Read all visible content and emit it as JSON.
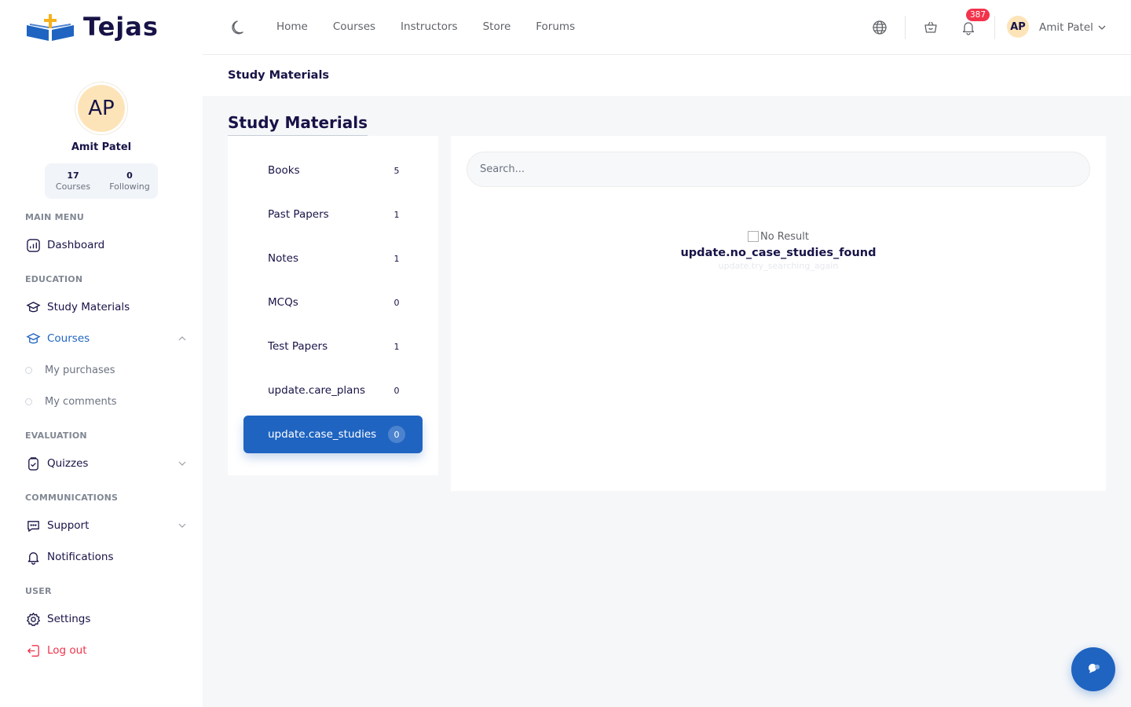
{
  "brand": {
    "name": "Tejas"
  },
  "profile": {
    "initials": "AP",
    "name": "Amit Patel",
    "stats": [
      {
        "value": "17",
        "label": "Courses"
      },
      {
        "value": "0",
        "label": "Following"
      }
    ]
  },
  "sidebar": {
    "sections": {
      "main_menu": "MAIN MENU",
      "education": "EDUCATION",
      "evaluation": "EVALUATION",
      "communications": "COMMUNICATIONS",
      "user": "USER"
    },
    "items": {
      "dashboard": "Dashboard",
      "study_materials": "Study Materials",
      "courses": "Courses",
      "my_purchases": "My purchases",
      "my_comments": "My comments",
      "quizzes": "Quizzes",
      "support": "Support",
      "notifications": "Notifications",
      "settings": "Settings",
      "logout": "Log out"
    }
  },
  "topnav": {
    "links": [
      "Home",
      "Courses",
      "Instructors",
      "Store",
      "Forums"
    ],
    "notification_count": "387",
    "user_initials": "AP",
    "user_name": "Amit Patel"
  },
  "breadcrumb": "Study Materials",
  "page": {
    "title": "Study Materials",
    "categories": [
      {
        "label": "Books",
        "count": "5"
      },
      {
        "label": "Past Papers",
        "count": "1"
      },
      {
        "label": "Notes",
        "count": "1"
      },
      {
        "label": "MCQs",
        "count": "0"
      },
      {
        "label": "Test Papers",
        "count": "1"
      },
      {
        "label": "update.care_plans",
        "count": "0"
      },
      {
        "label": "update.case_studies",
        "count": "0"
      }
    ],
    "search_placeholder": "Search...",
    "empty_state": {
      "image_alt": "No Result",
      "title": "update.no_case_studies_found",
      "hint": "update.try_searching_again"
    }
  },
  "colors": {
    "primary": "#1f64c1",
    "danger": "#f2334b",
    "text": "#171347",
    "avatar_bg": "#fde4b8"
  }
}
